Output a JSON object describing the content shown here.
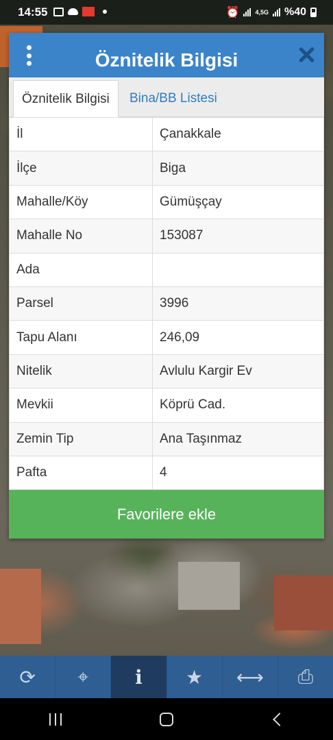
{
  "status_bar": {
    "time": "14:55",
    "battery": "%40",
    "network_label": "4,5G"
  },
  "dialog": {
    "title": "Öznitelik Bilgisi",
    "tabs": [
      {
        "label": "Öznitelik Bilgisi",
        "active": true
      },
      {
        "label": "Bina/BB Listesi",
        "active": false
      }
    ],
    "rows": [
      {
        "key": "İl",
        "value": "Çanakkale"
      },
      {
        "key": "İlçe",
        "value": "Biga"
      },
      {
        "key": "Mahalle/Köy",
        "value": "Gümüşçay"
      },
      {
        "key": "Mahalle No",
        "value": "153087"
      },
      {
        "key": "Ada",
        "value": ""
      },
      {
        "key": "Parsel",
        "value": "3996"
      },
      {
        "key": "Tapu Alanı",
        "value": "246,09"
      },
      {
        "key": "Nitelik",
        "value": "Avlulu Kargir Ev"
      },
      {
        "key": "Mevkii",
        "value": "Köprü Cad."
      },
      {
        "key": "Zemin Tip",
        "value": "Ana Taşınmaz"
      },
      {
        "key": "Pafta",
        "value": "4"
      }
    ],
    "favorite_button": "Favorilere ekle"
  },
  "toolbar": {
    "buttons": [
      {
        "icon": "refresh-icon",
        "glyph": "⟳"
      },
      {
        "icon": "locate-icon",
        "glyph": "⌖"
      },
      {
        "icon": "info-icon",
        "glyph": "i",
        "active": true
      },
      {
        "icon": "star-icon",
        "glyph": "★"
      },
      {
        "icon": "measure-icon",
        "glyph": "⟷"
      },
      {
        "icon": "print-icon",
        "glyph": "⎙"
      }
    ]
  },
  "colors": {
    "header": "#3b84c9",
    "favorite": "#57b35a",
    "toolbar": "#2f5e93",
    "tab_link": "#2f7cc0"
  }
}
